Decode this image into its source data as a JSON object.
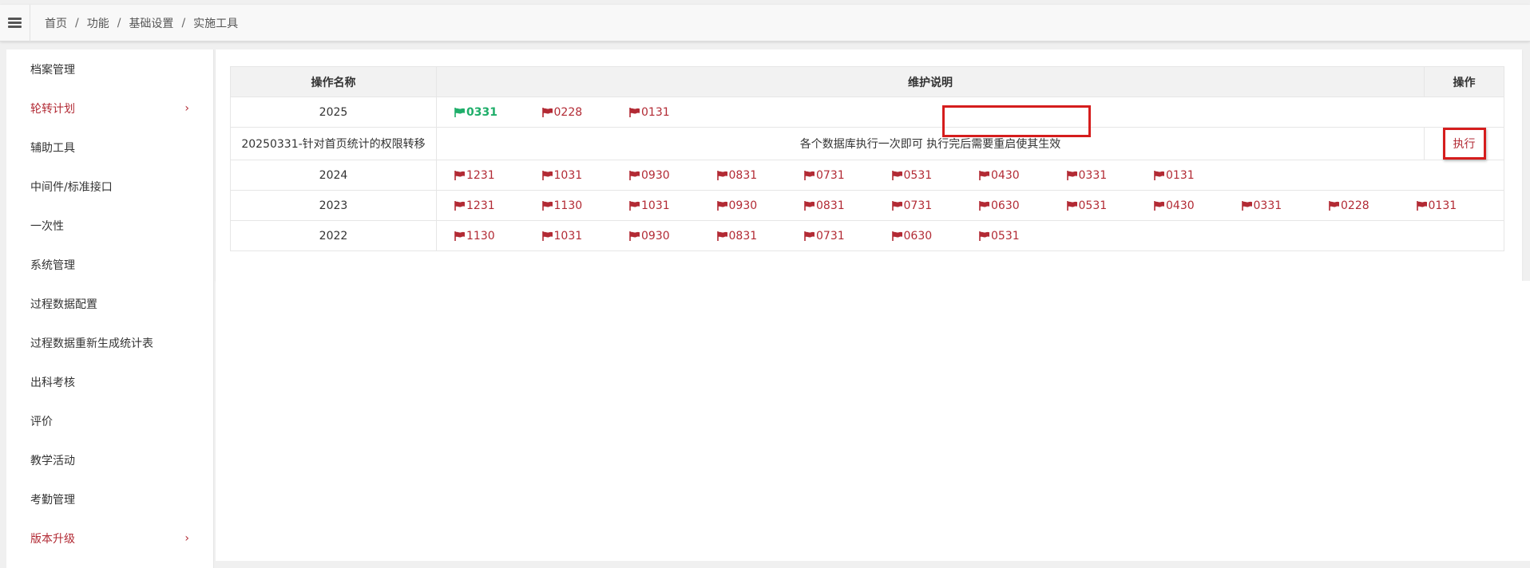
{
  "breadcrumb": [
    "首页",
    "功能",
    "基础设置",
    "实施工具"
  ],
  "sidebar": {
    "items": [
      {
        "label": "档案管理",
        "accent": false,
        "chevron": ""
      },
      {
        "label": "轮转计划",
        "accent": true,
        "chevron": "›"
      },
      {
        "label": "辅助工具",
        "accent": false,
        "chevron": ""
      },
      {
        "label": "中间件/标准接口",
        "accent": false,
        "chevron": ""
      },
      {
        "label": "一次性",
        "accent": false,
        "chevron": ""
      },
      {
        "label": "系统管理",
        "accent": false,
        "chevron": ""
      },
      {
        "label": "过程数据配置",
        "accent": false,
        "chevron": ""
      },
      {
        "label": "过程数据重新生成统计表",
        "accent": false,
        "chevron": ""
      },
      {
        "label": "出科考核",
        "accent": false,
        "chevron": ""
      },
      {
        "label": "评价",
        "accent": false,
        "chevron": ""
      },
      {
        "label": "教学活动",
        "accent": false,
        "chevron": ""
      },
      {
        "label": "考勤管理",
        "accent": false,
        "chevron": ""
      },
      {
        "label": "版本升级",
        "accent": true,
        "chevron": "›"
      }
    ]
  },
  "table": {
    "headers": {
      "name": "操作名称",
      "desc": "维护说明",
      "op": "操作"
    },
    "rows": [
      {
        "name": "2025",
        "flags": [
          "0331",
          "0228",
          "0131"
        ],
        "active": "0331"
      },
      {
        "name": "20250331-针对首页统计的权限转移",
        "desc": "各个数据库执行一次即可 执行完后需要重启使其生效",
        "action": "执行"
      },
      {
        "name": "2024",
        "flags": [
          "1231",
          "1031",
          "0930",
          "0831",
          "0731",
          "0531",
          "0430",
          "0331",
          "0131"
        ]
      },
      {
        "name": "2023",
        "flags": [
          "1231",
          "1130",
          "1031",
          "0930",
          "0831",
          "0731",
          "0630",
          "0531",
          "0430",
          "0331",
          "0228",
          "0131"
        ]
      },
      {
        "name": "2022",
        "flags": [
          "1130",
          "1031",
          "0930",
          "0831",
          "0731",
          "0630",
          "0531"
        ]
      }
    ]
  },
  "colors": {
    "accent": "#b22a34",
    "active": "#1fae6a",
    "highlight": "#d51d1d"
  },
  "icons": {
    "menu": "hamburger-icon",
    "flag": "flag-icon",
    "chevron": "chevron-right-icon"
  }
}
